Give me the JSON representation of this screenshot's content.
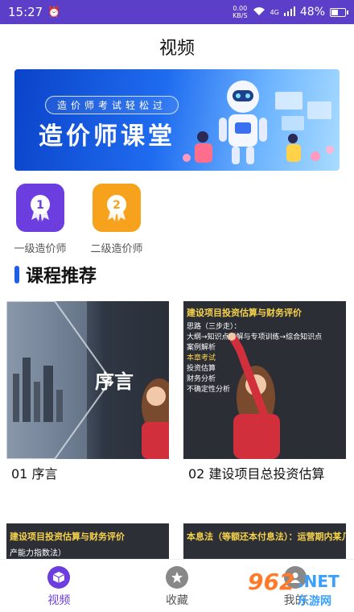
{
  "status_bar": {
    "time": "15:27",
    "net_speed": "0.00",
    "net_unit": "KB/S",
    "network": "4G",
    "battery": "48%"
  },
  "page": {
    "title": "视频"
  },
  "banner": {
    "subtitle": "造价师考试轻松过",
    "title": "造价师课堂"
  },
  "categories": [
    {
      "label": "一级造价师",
      "badge": "1",
      "color": "#6c3ee0"
    },
    {
      "label": "二级造价师",
      "badge": "2",
      "color": "#f6a21d"
    }
  ],
  "section": {
    "title": "课程推荐"
  },
  "courses": [
    {
      "title": "01 序言",
      "thumb_text": "序言"
    },
    {
      "title": "02 建设项目总投资估算",
      "thumb_heading": "建设项目投资估算与财务评价",
      "thumb_lines": [
        "思路（三步走）：",
        "大纲→知识点详解与专项训练→综合知识点",
        "案例解析",
        "本章考试",
        "投资估算",
        "财务分析",
        "不确定性分析"
      ]
    },
    {
      "thumb_heading": "建设项目投资估算与财务评价",
      "thumb_line": "产能力指数法）"
    },
    {
      "thumb_heading": "本息法（等额还本付息法）：运营期内某几年",
      "thumb_line": ""
    }
  ],
  "tabs": [
    {
      "label": "视频",
      "active": true
    },
    {
      "label": "收藏",
      "active": false
    },
    {
      "label": "我的",
      "active": false
    }
  ],
  "watermark": {
    "number": "962",
    "net": ".NET",
    "sub": "乐游网"
  },
  "colors": {
    "accent": "#5b3fc9",
    "section_bar": "#1f5fe6"
  }
}
